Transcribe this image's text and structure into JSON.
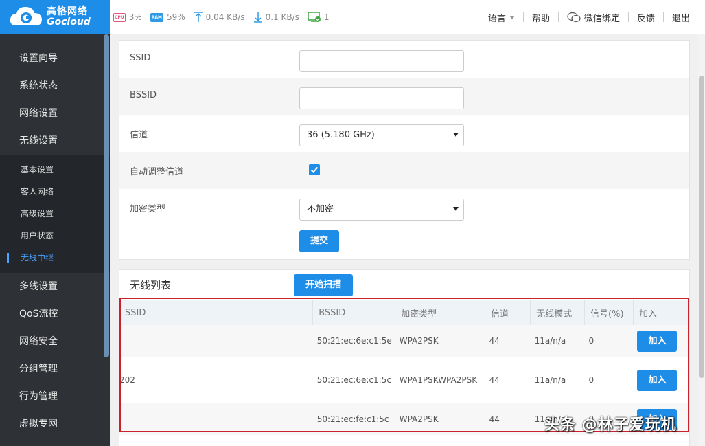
{
  "brand": {
    "cn": "高恪网络",
    "en": "Gocloud"
  },
  "stats": {
    "cpu_label": "CPU",
    "cpu": "3%",
    "ram_label": "RAM",
    "ram": "59%",
    "up": "0.04 KB/s",
    "down": "0.1 KB/s",
    "devices": "1"
  },
  "topmenu": {
    "language": "语言",
    "help": "帮助",
    "wechat": "微信绑定",
    "feedback": "反馈",
    "logout": "退出"
  },
  "sidebar": {
    "items": [
      {
        "label": "设置向导"
      },
      {
        "label": "系统状态"
      },
      {
        "label": "网络设置"
      },
      {
        "label": "无线设置"
      }
    ],
    "sub": [
      {
        "label": "基本设置"
      },
      {
        "label": "客人网络"
      },
      {
        "label": "高级设置"
      },
      {
        "label": "用户状态"
      },
      {
        "label": "无线中继"
      }
    ],
    "items2": [
      {
        "label": "多线设置"
      },
      {
        "label": "QoS流控"
      },
      {
        "label": "网络安全"
      },
      {
        "label": "分组管理"
      },
      {
        "label": "行为管理"
      },
      {
        "label": "虚拟专网"
      }
    ]
  },
  "form": {
    "ssid_label": "SSID",
    "ssid_value": "",
    "bssid_label": "BSSID",
    "bssid_value": "",
    "channel_label": "信道",
    "channel_value": "36 (5.180 GHz)",
    "auto_channel_label": "自动调整信道",
    "auto_channel_checked": true,
    "encryption_label": "加密类型",
    "encryption_value": "不加密",
    "submit": "提交"
  },
  "list": {
    "title": "无线列表",
    "scan": "开始扫描",
    "columns": [
      "SSID",
      "BSSID",
      "加密类型",
      "信道",
      "无线模式",
      "信号(%)",
      "加入"
    ],
    "rows": [
      {
        "ssid": "",
        "bssid": "50:21:ec:6e:c1:5e",
        "enc": "WPA2PSK",
        "channel": "44",
        "mode": "11a/n/a",
        "signal": "0",
        "join": "加入"
      },
      {
        "ssid": "202",
        "bssid": "50:21:ec:6e:c1:5c",
        "enc": "WPA1PSKWPA2PSK",
        "channel": "44",
        "mode": "11a/n/a",
        "signal": "0",
        "join": "加入"
      },
      {
        "ssid": "",
        "bssid": "50:21:ec:fe:c1:5c",
        "enc": "WPA2PSK",
        "channel": "44",
        "mode": "11a/n/a",
        "signal": "0",
        "join": "加入"
      }
    ]
  },
  "watermark": "头条 @林子爱玩机"
}
